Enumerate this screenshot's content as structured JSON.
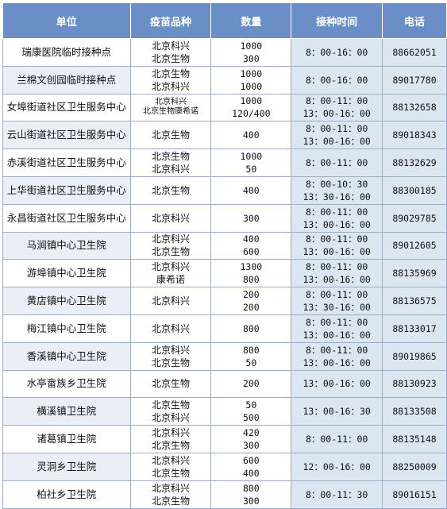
{
  "headers": [
    "单位",
    "疫苗品种",
    "数量",
    "接种时间",
    "电话"
  ],
  "rows": [
    {
      "unit": "瑞康医院临时接种点",
      "vaccines": [
        "北京科兴",
        "北京生物"
      ],
      "qty": [
        "1000",
        "300"
      ],
      "time": [
        "8：00-16：00"
      ],
      "phone": "88662051"
    },
    {
      "unit": "兰棉文创园临时接种点",
      "vaccines": [
        "北京生物",
        "北京科兴"
      ],
      "qty": [
        "1000",
        "1000"
      ],
      "time": [
        "8：00-16：00"
      ],
      "phone": "89017780"
    },
    {
      "unit": "女埠街道社区卫生服务中心",
      "vaccines": [
        "北京科兴",
        "北京生物康希诺"
      ],
      "qty": [
        "1000",
        "120/400"
      ],
      "time": [
        "8：00-11：00",
        "13：00-16：00"
      ],
      "phone": "88132658"
    },
    {
      "unit": "云山街道社区卫生服务中心",
      "vaccines": [
        "北京生物"
      ],
      "qty": [
        "400"
      ],
      "time": [
        "8：00-11：00",
        "13：00-16：00"
      ],
      "phone": "89018343"
    },
    {
      "unit": "赤溪街道社区卫生服务中心",
      "vaccines": [
        "北京生物",
        "北京科兴"
      ],
      "qty": [
        "1000",
        "50"
      ],
      "time": [
        "8：00-11：00"
      ],
      "phone": "88132629"
    },
    {
      "unit": "上华街道社区卫生服务中心",
      "vaccines": [
        "北京生物"
      ],
      "qty": [
        "400"
      ],
      "time": [
        "8：00-10：30",
        "13：30-16：00"
      ],
      "phone": "88300185"
    },
    {
      "unit": "永昌街道社区卫生服务中心",
      "vaccines": [
        "北京科兴"
      ],
      "qty": [
        "300"
      ],
      "time": [
        "8：00-11：00",
        "13：00-16：00"
      ],
      "phone": "89029785"
    },
    {
      "unit": "马涧镇中心卫生院",
      "vaccines": [
        "北京科兴",
        "北京生物"
      ],
      "qty": [
        "400",
        "600"
      ],
      "time": [
        "8：00-11：00",
        "13：00-16：00"
      ],
      "phone": "89012605"
    },
    {
      "unit": "游埠镇中心卫生院",
      "vaccines": [
        "北京科兴",
        "康希诺"
      ],
      "qty": [
        "1300",
        "800"
      ],
      "time": [
        "8：00-11：00",
        "13：00-16：00"
      ],
      "phone": "88135969"
    },
    {
      "unit": "黄店镇中心卫生院",
      "vaccines": [
        "北京科兴"
      ],
      "qty": [
        "200",
        "200"
      ],
      "time": [
        "8：00-11：00",
        "13：30-16：00"
      ],
      "phone": "88136575"
    },
    {
      "unit": "梅江镇中心卫生院",
      "vaccines": [
        "北京科兴"
      ],
      "qty": [
        "800"
      ],
      "time": [
        "8：00-11：00",
        "13：00-16：00"
      ],
      "phone": "88133017"
    },
    {
      "unit": "香溪镇中心卫生院",
      "vaccines": [
        "北京科兴",
        "北京生物"
      ],
      "qty": [
        "800",
        "50"
      ],
      "time": [
        "8：00-11：00",
        "13：00-16：00"
      ],
      "phone": "89019865"
    },
    {
      "unit": "水亭畲族乡卫生院",
      "vaccines": [
        "北京生物"
      ],
      "qty": [
        "200"
      ],
      "time": [
        "13：00-16：00"
      ],
      "phone": "88130923"
    },
    {
      "unit": "横溪镇卫生院",
      "vaccines": [
        "北京生物",
        "北京科兴"
      ],
      "qty": [
        "50",
        "500"
      ],
      "time": [
        "13：00-16：30"
      ],
      "phone": "88133508"
    },
    {
      "unit": "诸葛镇卫生院",
      "vaccines": [
        "北京科兴",
        "北京生物"
      ],
      "qty": [
        "420",
        "300"
      ],
      "time": [
        "8：00-11：00"
      ],
      "phone": "88135148"
    },
    {
      "unit": "灵洞乡卫生院",
      "vaccines": [
        "北京科兴",
        "北京生物"
      ],
      "qty": [
        "600",
        "400"
      ],
      "time": [
        "12：00-16：00"
      ],
      "phone": "88250009"
    },
    {
      "unit": "柏社乡卫生院",
      "vaccines": [
        "北京科兴",
        "北京生物"
      ],
      "qty": [
        "800",
        "300"
      ],
      "time": [
        "8：00-11：30"
      ],
      "phone": "89016151"
    }
  ]
}
